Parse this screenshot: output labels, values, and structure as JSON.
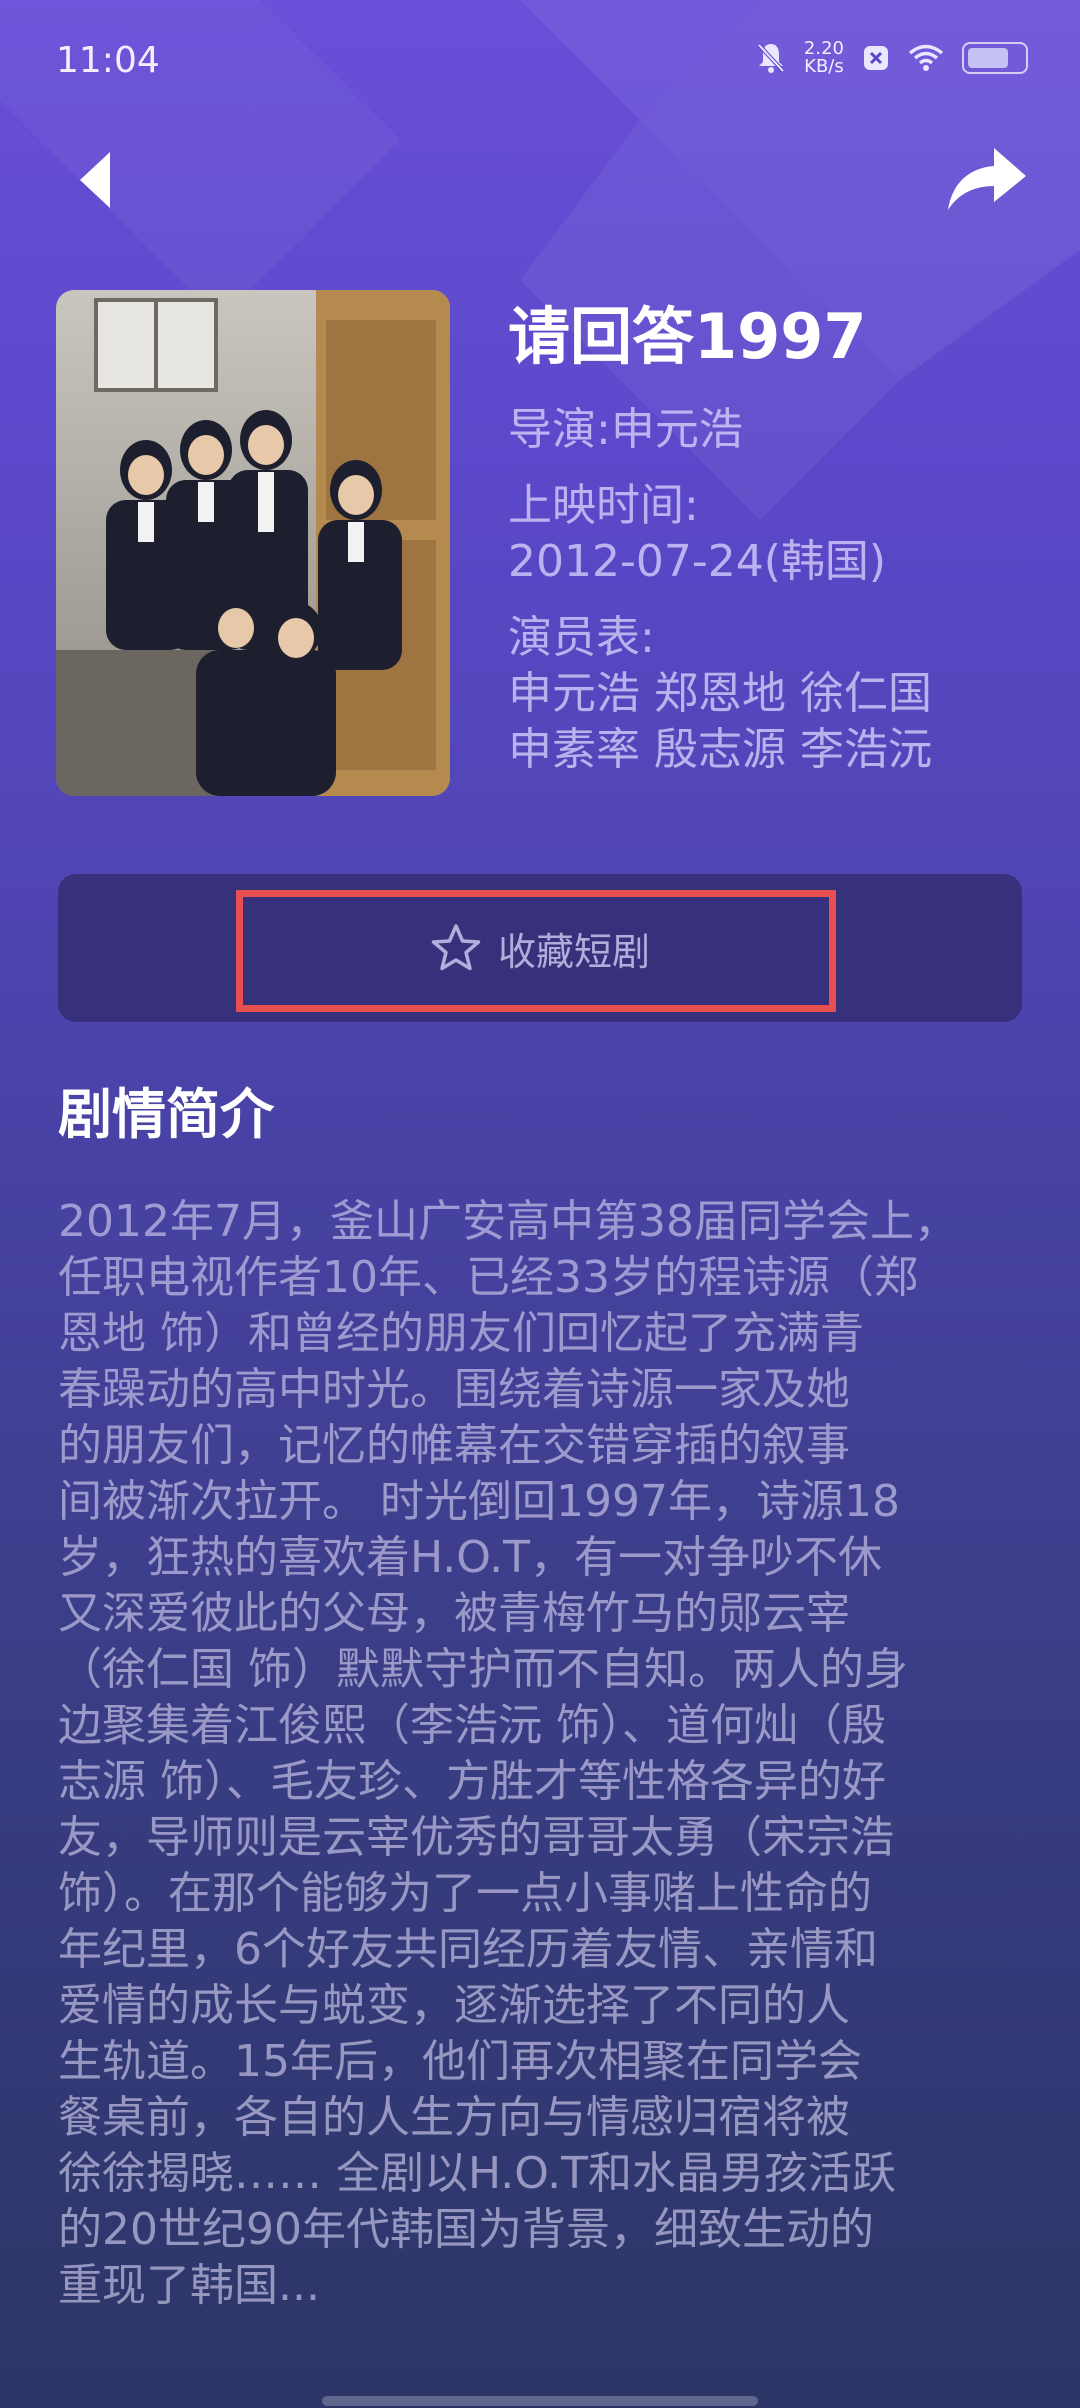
{
  "status_bar": {
    "time": "11:04",
    "net_speed_value": "2.20",
    "net_speed_unit": "KB/s",
    "icons": [
      "mute-bell-icon",
      "app-notification-icon",
      "wifi-icon",
      "battery-icon"
    ]
  },
  "nav": {
    "back_icon": "back-arrow-icon",
    "share_icon": "share-arrow-icon"
  },
  "drama": {
    "title": "请回答1997",
    "director": "导演:申元浩",
    "release_label": "上映时间:",
    "release_value": "2012-07-24(韩国)",
    "cast_label": "演员表:",
    "cast_line1": "申元浩 郑恩地 徐仁国",
    "cast_line2": "申素率 殷志源 李浩沅"
  },
  "favorite": {
    "icon": "star-icon",
    "label": "收藏短剧"
  },
  "synopsis": {
    "heading": "剧情简介",
    "lines": [
      "2012年7月，釜山广安高中第38届同学会上，",
      "任职电视作者10年、已经33岁的程诗源（郑",
      "恩地 饰）和曾经的朋友们回忆起了充满青",
      "春躁动的高中时光。围绕着诗源一家及她",
      "的朋友们，记忆的帷幕在交错穿插的叙事",
      "间被渐次拉开。 时光倒回1997年，诗源18",
      "岁，狂热的喜欢着H.O.T，有一对争吵不休",
      "又深爱彼此的父母，被青梅竹马的郧云宰",
      "（徐仁国 饰）默默守护而不自知。两人的身",
      "边聚集着江俊熙（李浩沅 饰）、道何灿（殷",
      "志源 饰）、毛友珍、方胜才等性格各异的好",
      "友，导师则是云宰优秀的哥哥太勇（宋宗浩",
      "饰）。在那个能够为了一点小事赌上性命的",
      "年纪里，6个好友共同经历着友情、亲情和",
      "爱情的成长与蜕变，逐渐选择了不同的人",
      "生轨道。15年后，他们再次相聚在同学会",
      "餐桌前，各自的人生方向与情感归宿将被",
      "徐徐揭晓…… 全剧以H.O.T和水晶男孩活跃",
      "的20世纪90年代韩国为背景，细致生动的",
      "重现了韩国..."
    ]
  },
  "colors": {
    "highlight_border": "#e8504f",
    "favorite_bar": "#37307a"
  }
}
